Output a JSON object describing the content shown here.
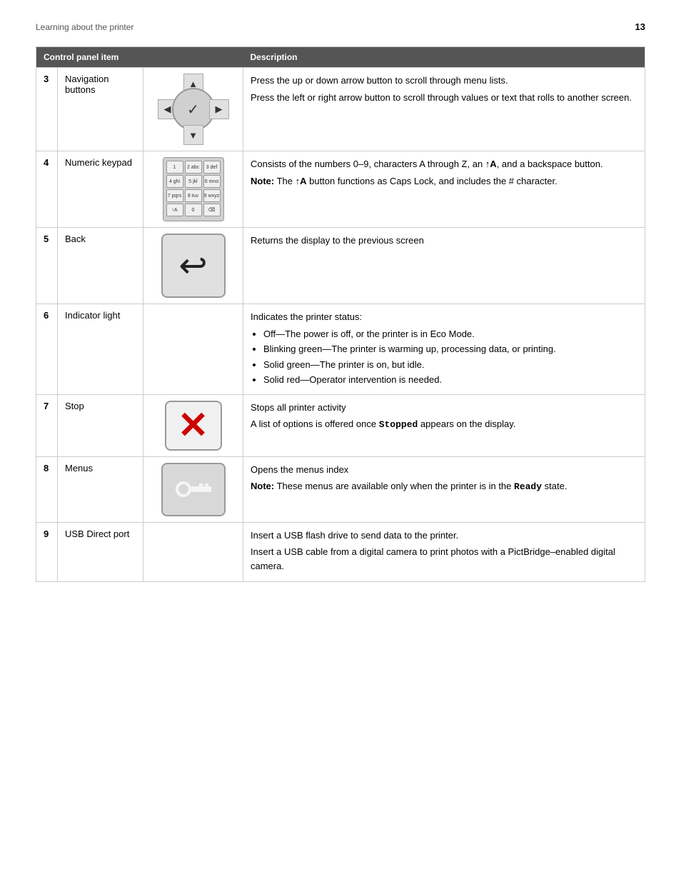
{
  "header": {
    "left": "Learning about the printer",
    "right": "13"
  },
  "table": {
    "col1": "Control panel item",
    "col2": "Description",
    "rows": [
      {
        "num": "3",
        "label": "Navigation buttons",
        "image_type": "nav",
        "description": [
          "Press the up or down arrow button to scroll through menu lists.",
          "Press the left or right arrow button to scroll through values or text that rolls to another screen."
        ]
      },
      {
        "num": "4",
        "label": "Numeric keypad",
        "image_type": "keypad",
        "description_main": "Consists of the numbers 0–9, characters A through Z, an ↑A, and a backspace button.",
        "description_note": "Note: The ↑A button functions as Caps Lock, and includes the # character."
      },
      {
        "num": "5",
        "label": "Back",
        "image_type": "back",
        "description": [
          "Returns the display to the previous screen"
        ]
      },
      {
        "num": "6",
        "label": "Indicator light",
        "image_type": "none",
        "description_main": "Indicates the printer status:",
        "bullets": [
          "Off—The power is off, or the printer is in Eco Mode.",
          "Blinking green—The printer is warming up, processing data, or printing.",
          "Solid green—The printer is on, but idle.",
          "Solid red—Operator intervention is needed."
        ]
      },
      {
        "num": "7",
        "label": "Stop",
        "image_type": "stop",
        "description": [
          "Stops all printer activity",
          "A list of options is offered once Stopped appears on the display."
        ]
      },
      {
        "num": "8",
        "label": "Menus",
        "image_type": "menus",
        "description_main": "Opens the menus index",
        "description_note": "Note: These menus are available only when the printer is in the Ready state."
      },
      {
        "num": "9",
        "label": "USB Direct port",
        "image_type": "none",
        "description": [
          "Insert a USB flash drive to send data to the printer.",
          "Insert a USB cable from a digital camera to print photos with a PictBridge–enabled digital camera."
        ]
      }
    ]
  }
}
